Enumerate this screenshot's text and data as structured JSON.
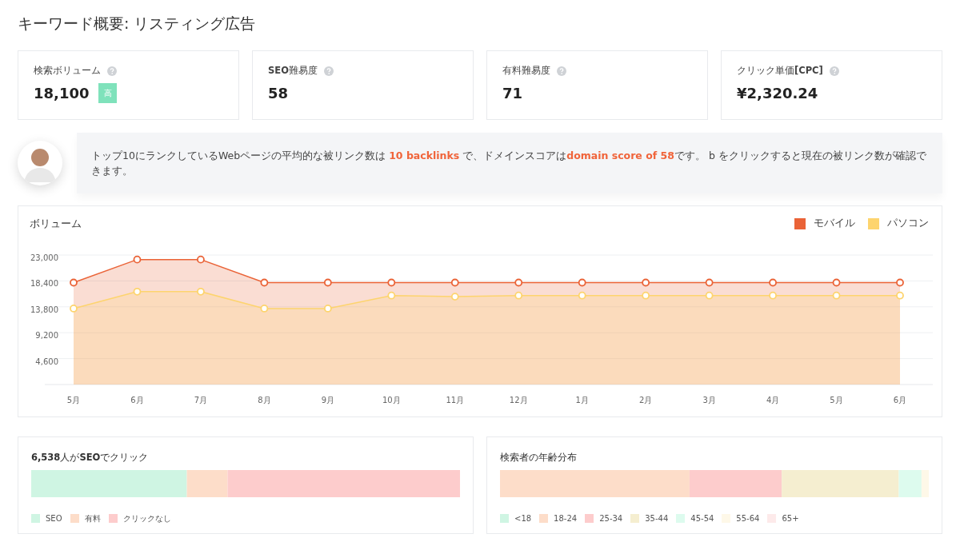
{
  "page_title": "キーワード概要: リスティング広告",
  "metrics": [
    {
      "label": "検索ボリューム",
      "value": "18,100",
      "badge": "高"
    },
    {
      "label": "**SEO**難易度",
      "value": "58"
    },
    {
      "label": "有料難易度",
      "value": "71"
    },
    {
      "label": "クリック単価**[CPC]**",
      "value": "¥2,320.24"
    }
  ],
  "tip": {
    "parts": [
      {
        "kind": "plain",
        "text": "トップ10にランクしているWebページの平均的な被リンク数は "
      },
      {
        "kind": "highlight",
        "text": "10 backlinks"
      },
      {
        "kind": "plain",
        "text": " で、ドメインスコアは"
      },
      {
        "kind": "highlight",
        "text": "domain score of 58"
      },
      {
        "kind": "plain",
        "text": "です。 b をクリックすると現在の被リンク数が確認できます。"
      }
    ]
  },
  "volume": {
    "title": "ボリューム",
    "chart_data": {
      "type": "area",
      "categories": [
        "5月",
        "6月",
        "7月",
        "8月",
        "9月",
        "10月",
        "11月",
        "12月",
        "1月",
        "2月",
        "3月",
        "4月",
        "5月",
        "6月"
      ],
      "ylim": [
        0,
        23000
      ],
      "grid": true,
      "yticks": [
        {
          "value": 4600,
          "label": "4,600"
        },
        {
          "value": 9200,
          "label": "9,200"
        },
        {
          "value": 13800,
          "label": "13,800"
        },
        {
          "value": 18400,
          "label": "18,400"
        },
        {
          "value": 23000,
          "label": "23,000"
        }
      ],
      "series": [
        {
          "name": "モバイル",
          "color": "#ea6337",
          "values": [
            18100,
            22200,
            22200,
            18100,
            18100,
            18100,
            18100,
            18100,
            18100,
            18100,
            18100,
            18100,
            18100,
            18100
          ]
        },
        {
          "name": "パソコン",
          "color": "#fdd46e",
          "values": [
            13500,
            16500,
            16500,
            13500,
            13500,
            15800,
            15600,
            15800,
            15800,
            15800,
            15800,
            15800,
            15800,
            15800
          ]
        }
      ]
    }
  },
  "clicks": {
    "title": "**6,538**人が**SEO**でクリック",
    "segments": [
      {
        "label": "SEO",
        "color": "#cff5e3"
      },
      {
        "label": "有料",
        "color": "#fdddc9"
      },
      {
        "label": "クリックなし",
        "color": "#fdcccc"
      }
    ]
  },
  "ages": {
    "title": "検索者の年齢分布",
    "segments": [
      {
        "label": "<18",
        "color": "#cff5e3"
      },
      {
        "label": "18-24",
        "color": "#fdddc9"
      },
      {
        "label": "25-34",
        "color": "#fdcccc"
      },
      {
        "label": "35-44",
        "color": "#f5eed0"
      },
      {
        "label": "45-54",
        "color": "#ddfbee"
      },
      {
        "label": "55-64",
        "color": "#fef8e8"
      },
      {
        "label": "65+",
        "color": "#fdeaea"
      }
    ]
  }
}
